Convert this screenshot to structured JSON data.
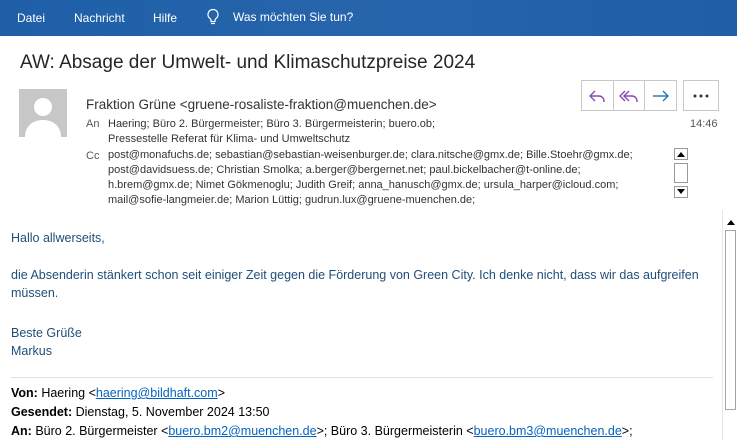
{
  "ribbon": {
    "tabs": [
      "Datei",
      "Nachricht",
      "Hilfe"
    ],
    "tell_me": "Was möchten Sie tun?",
    "colors": {
      "background": "#1e5fa8",
      "text": "#ffffff"
    }
  },
  "message": {
    "subject": "AW: Absage der Umwelt- und Klimaschutzpreise 2024",
    "sender": "Fraktion Grüne <gruene-rosaliste-fraktion@muenchen.de>",
    "to_label": "An",
    "to_lines": [
      "Haering; Büro 2. Bürgermeister; Büro 3. Bürgermeisterin; buero.ob;",
      "Pressestelle Referat für Klima- und Umweltschutz"
    ],
    "cc_label": "Cc",
    "cc_lines": [
      "post@monafuchs.de; sebastian@sebastian-weisenburger.de; clara.nitsche@gmx.de; Bille.Stoehr@gmx.de;",
      "post@davidsuess.de; Christian Smolka; a.berger@bergernet.net; paul.bickelbacher@t-online.de;",
      "h.brem@gmx.de; Nimet Gökmenoglu; Judith Greif; anna_hanusch@gmx.de; ursula_harper@icloud.com;",
      "mail@sofie-langmeier.de; Marion Lüttig; gudrun.lux@gruene-muenchen.de;"
    ],
    "time": "14:46",
    "actions": {
      "reply": "reply-icon",
      "reply_all": "reply-all-icon",
      "forward": "forward-icon",
      "more": "more-icon"
    },
    "accent_color": "#8b4ab1"
  },
  "body": {
    "greeting": "Hallo allwerseits,",
    "paragraph_line1": "die Absenderin stänkert schon seit einiger Zeit gegen die Förderung von Green City. Ich denke nicht, dass wir das aufgreifen",
    "paragraph_line2": "müssen.",
    "closing": "Beste Grüße",
    "signature": "Markus",
    "text_color": "#1f4e79"
  },
  "quoted": {
    "from_label": "Von:",
    "from_name": "Haering <",
    "from_email": "haering@bildhaft.com",
    "from_end": ">",
    "sent_label": "Gesendet:",
    "sent_value": "Dienstag, 5. November 2024 13:50",
    "to_label": "An:",
    "to_part1": "Büro 2. Bürgermeister <",
    "to_email1": "buero.bm2@muenchen.de",
    "to_part2": ">; Büro 3. Bürgermeisterin <",
    "to_email2": "buero.bm3@muenchen.de",
    "to_part3": ">;"
  }
}
